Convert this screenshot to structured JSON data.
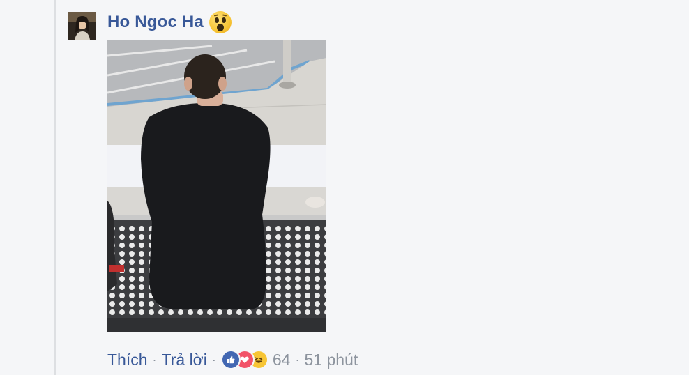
{
  "comment": {
    "author": {
      "name": "Ho Ngoc Ha",
      "reaction_emoji": "wow-face-icon"
    },
    "actions": {
      "like_label": "Thích",
      "reply_label": "Trả lời",
      "separator": "·",
      "reaction_count": "64",
      "timestamp": "51 phút"
    },
    "reaction_icons": [
      "like-icon",
      "love-icon",
      "haha-icon"
    ]
  },
  "colors": {
    "link": "#385898",
    "muted": "#8d949e",
    "background": "#f5f6f8",
    "like": "#4267b2",
    "love": "#f25268",
    "haha": "#f7c535"
  }
}
